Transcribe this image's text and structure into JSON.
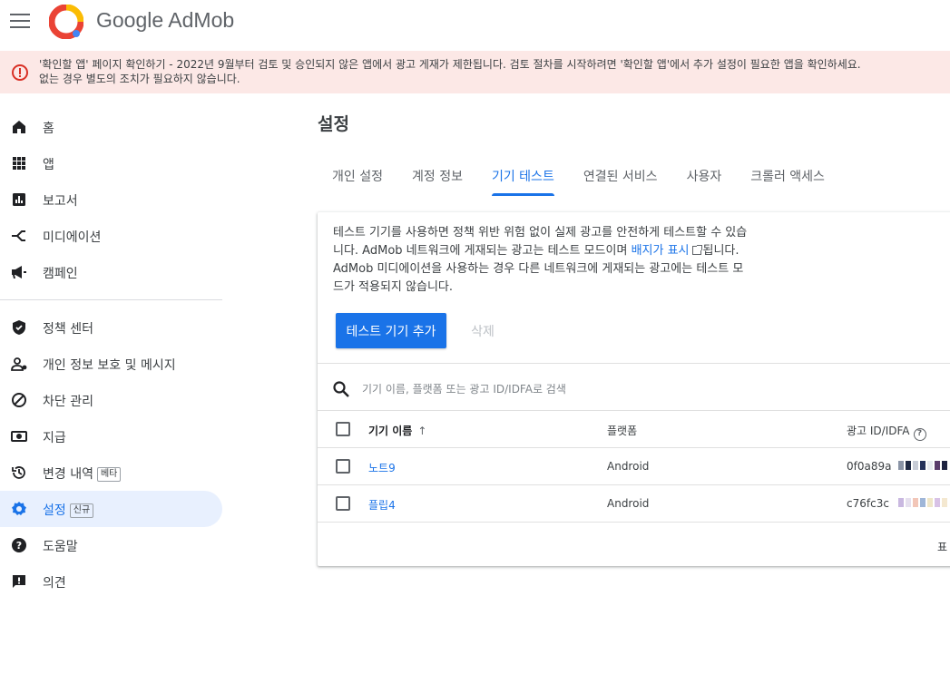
{
  "header": {
    "menu_icon": "hamburger-menu-icon",
    "logo_icon": "admob-logo-icon",
    "brand_prefix": "Google",
    "brand_name": "AdMob"
  },
  "banner": {
    "icon": "error-circle-icon",
    "line1": "'확인할 앱' 페이지 확인하기 - 2022년 9월부터 검토 및 승인되지 않은 앱에서 광고 게재가 제한됩니다. 검토 절차를 시작하려면 '확인할 앱'에서 추가 설정이 필요한 앱을 확인하세요.",
    "line2": "없는 경우 별도의 조치가 필요하지 않습니다."
  },
  "sidebar": {
    "items": [
      {
        "label": "홈",
        "icon": "home-icon"
      },
      {
        "label": "앱",
        "icon": "apps-grid-icon"
      },
      {
        "label": "보고서",
        "icon": "reports-icon"
      },
      {
        "label": "미디에이션",
        "icon": "mediation-icon"
      },
      {
        "label": "캠페인",
        "icon": "campaign-megaphone-icon"
      },
      {
        "label": "정책 센터",
        "icon": "policy-shield-icon"
      },
      {
        "label": "개인 정보 보호 및 메시지",
        "icon": "privacy-person-icon"
      },
      {
        "label": "차단 관리",
        "icon": "block-icon"
      },
      {
        "label": "지급",
        "icon": "payments-icon"
      },
      {
        "label": "변경 내역",
        "icon": "history-icon",
        "badge": "베타"
      },
      {
        "label": "설정",
        "icon": "settings-gear-icon",
        "badge": "신규",
        "active": true
      },
      {
        "label": "도움말",
        "icon": "help-icon"
      },
      {
        "label": "의견",
        "icon": "feedback-icon"
      }
    ]
  },
  "main": {
    "title": "설정",
    "tabs": [
      {
        "label": "개인 설정"
      },
      {
        "label": "계정 정보"
      },
      {
        "label": "기기 테스트",
        "active": true
      },
      {
        "label": "연결된 서비스"
      },
      {
        "label": "사용자"
      },
      {
        "label": "크롤러 액세스"
      }
    ],
    "description": {
      "part1": "테스트 기기를 사용하면 정책 위반 위험 없이 실제 광고를 안전하게 테스트할 수 있습니다. AdMob 네트워크에 게재되는 광고는 테스트 모드이며 ",
      "link": "배지가 표시",
      "part2": "됩니다. AdMob 미디에이션을 사용하는 경우 다른 네트워크에 게재되는 광고에는 테스트 모드가 적용되지 않습니다."
    },
    "add_button": "테스트 기기 추가",
    "delete_button": "삭제",
    "search": {
      "icon": "search-icon",
      "placeholder": "기기 이름, 플랫폼 또는 광고 ID/IDFA로 검색"
    },
    "table": {
      "columns": {
        "name": "기기 이름",
        "platform": "플랫폼",
        "ad_id": "광고 ID/IDFA"
      },
      "rows": [
        {
          "name": "노트9",
          "platform": "Android",
          "ad_id": "0f0a89a"
        },
        {
          "name": "플립4",
          "platform": "Android",
          "ad_id": "c76fc3c"
        }
      ],
      "footer": "표"
    }
  },
  "colors": {
    "accent": "#1a73e8",
    "banner_bg": "#fce8e6",
    "error": "#d93025",
    "active_nav_bg": "#e8f0fe"
  }
}
